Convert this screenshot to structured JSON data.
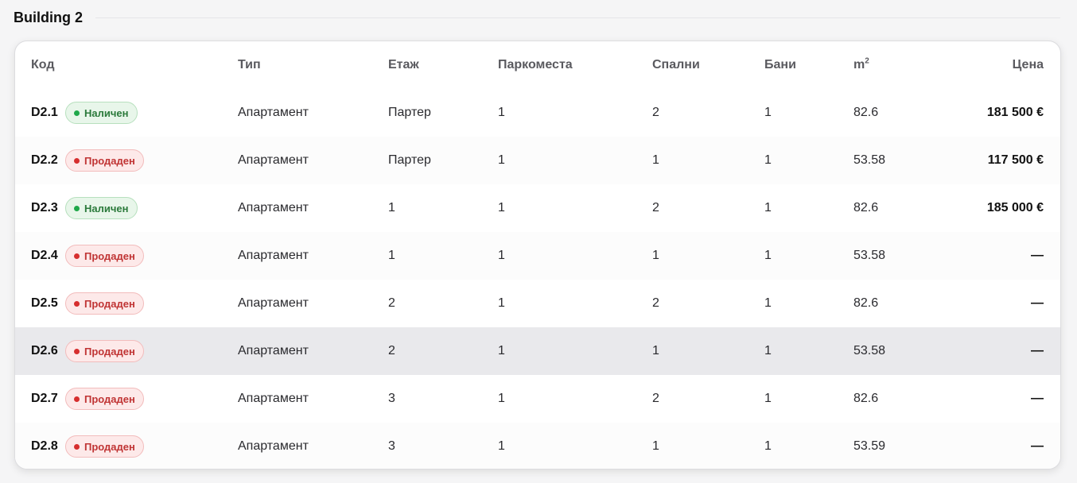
{
  "section": {
    "title": "Building 2"
  },
  "table": {
    "headers": {
      "code": "Код",
      "type": "Тип",
      "floor": "Етаж",
      "parking": "Паркоместа",
      "bedrooms": "Спални",
      "bathrooms": "Бани",
      "area_base": "m",
      "area_sup": "2",
      "price": "Цена"
    },
    "rows": [
      {
        "code": "D2.1",
        "status": "Наличен",
        "status_kind": "available",
        "type": "Апартамент",
        "floor": "Партер",
        "parking": "1",
        "bedrooms": "2",
        "bathrooms": "1",
        "area": "82.6",
        "price": "181 500 €"
      },
      {
        "code": "D2.2",
        "status": "Продаден",
        "status_kind": "sold",
        "type": "Апартамент",
        "floor": "Партер",
        "parking": "1",
        "bedrooms": "1",
        "bathrooms": "1",
        "area": "53.58",
        "price": "117 500 €"
      },
      {
        "code": "D2.3",
        "status": "Наличен",
        "status_kind": "available",
        "type": "Апартамент",
        "floor": "1",
        "parking": "1",
        "bedrooms": "2",
        "bathrooms": "1",
        "area": "82.6",
        "price": "185 000 €"
      },
      {
        "code": "D2.4",
        "status": "Продаден",
        "status_kind": "sold",
        "type": "Апартамент",
        "floor": "1",
        "parking": "1",
        "bedrooms": "1",
        "bathrooms": "1",
        "area": "53.58",
        "price": "—"
      },
      {
        "code": "D2.5",
        "status": "Продаден",
        "status_kind": "sold",
        "type": "Апартамент",
        "floor": "2",
        "parking": "1",
        "bedrooms": "2",
        "bathrooms": "1",
        "area": "82.6",
        "price": "—"
      },
      {
        "code": "D2.6",
        "status": "Продаден",
        "status_kind": "sold",
        "type": "Апартамент",
        "floor": "2",
        "parking": "1",
        "bedrooms": "1",
        "bathrooms": "1",
        "area": "53.58",
        "price": "—"
      },
      {
        "code": "D2.7",
        "status": "Продаден",
        "status_kind": "sold",
        "type": "Апартамент",
        "floor": "3",
        "parking": "1",
        "bedrooms": "2",
        "bathrooms": "1",
        "area": "82.6",
        "price": "—"
      },
      {
        "code": "D2.8",
        "status": "Продаден",
        "status_kind": "sold",
        "type": "Апартамент",
        "floor": "3",
        "parking": "1",
        "bedrooms": "1",
        "bathrooms": "1",
        "area": "53.59",
        "price": "—"
      }
    ]
  },
  "colors": {
    "available_dot": "#1fa84a",
    "sold_dot": "#d62e2e",
    "hover_row": "#e9e9ec"
  }
}
